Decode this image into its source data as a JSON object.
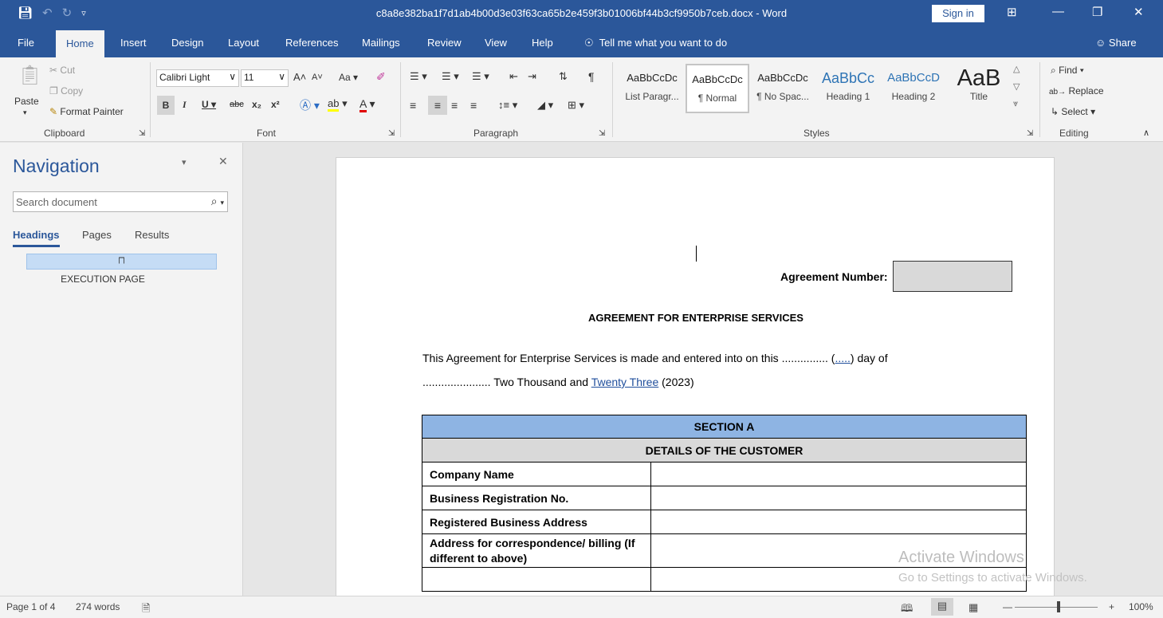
{
  "title_bar": {
    "filename": "c8a8e382ba1f7d1ab4b00d3e03f63ca65b2e459f3b01006bf44b3cf9950b7ceb.docx",
    "app_suffix": " - Word",
    "sign_in": "Sign in"
  },
  "tabs": [
    "File",
    "Home",
    "Insert",
    "Design",
    "Layout",
    "References",
    "Mailings",
    "Review",
    "View",
    "Help"
  ],
  "tell_me": "Tell me what you want to do",
  "share": "Share",
  "clipboard": {
    "paste": "Paste",
    "cut": "Cut",
    "copy": "Copy",
    "format_painter": "Format Painter",
    "label": "Clipboard"
  },
  "font": {
    "name": "Calibri Light",
    "size": "11",
    "label": "Font"
  },
  "paragraph": {
    "label": "Paragraph"
  },
  "styles": {
    "label": "Styles",
    "items": [
      {
        "sample": "AaBbCcDc",
        "name": "List Paragr..."
      },
      {
        "sample": "AaBbCcDc",
        "name": "¶ Normal"
      },
      {
        "sample": "AaBbCcDc",
        "name": "¶ No Spac..."
      },
      {
        "sample": "AaBbCc",
        "name": "Heading 1"
      },
      {
        "sample": "AaBbCcD",
        "name": "Heading 2"
      },
      {
        "sample": "AaB",
        "name": "Title"
      }
    ]
  },
  "editing": {
    "find": "Find",
    "replace": "Replace",
    "select": "Select",
    "label": "Editing"
  },
  "navigation": {
    "title": "Navigation",
    "search_placeholder": "Search document",
    "tabs": [
      "Headings",
      "Pages",
      "Results"
    ],
    "heading_item": "EXECUTION PAGE"
  },
  "document": {
    "agreement_label": "Agreement Number:",
    "title": "AGREEMENT FOR ENTERPRISE SERVICES",
    "para1_pre": "This Agreement for Enterprise Services is made and entered into on this ............... (",
    "para1_link": ".....",
    "para1_post": ") day of",
    "para2_pre": "...................... Two Thousand and ",
    "para2_link": "Twenty Three",
    "para2_post": " (2023)",
    "table": {
      "section": "SECTION A",
      "subheading": "DETAILS OF THE CUSTOMER",
      "rows": [
        "Company Name",
        "Business Registration No.",
        "Registered Business Address",
        "Address for correspondence/ billing (If different to above)"
      ]
    }
  },
  "watermark": {
    "line1": "Activate Windows",
    "line2": "Go to Settings to activate Windows."
  },
  "status": {
    "page": "Page 1 of 4",
    "words": "274 words",
    "zoom": "100%"
  }
}
